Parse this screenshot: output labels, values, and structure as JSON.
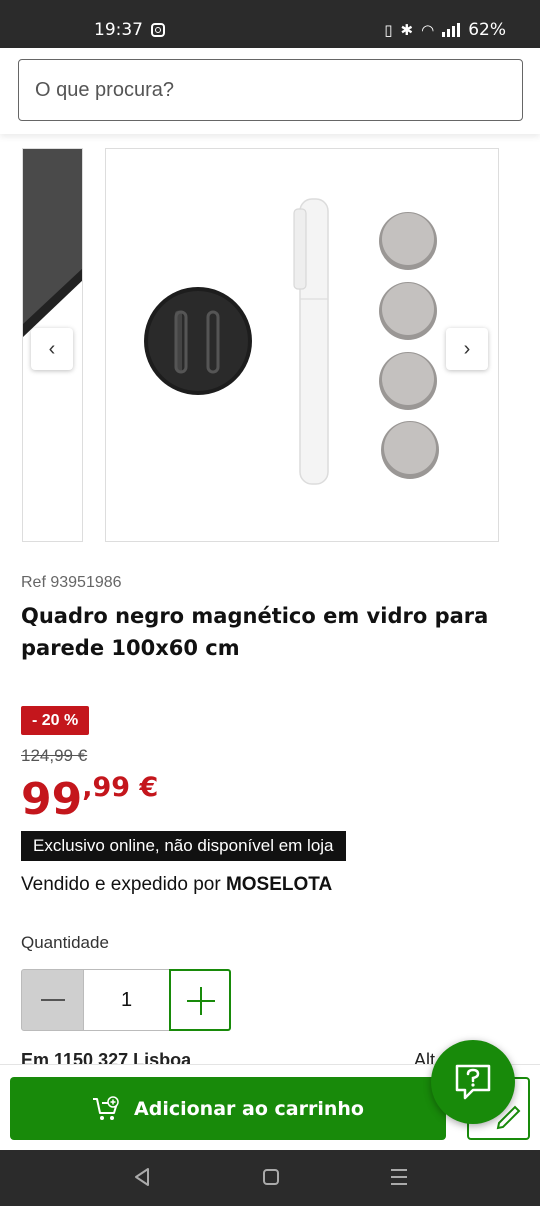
{
  "status_bar": {
    "time": "19:37",
    "battery": "62%",
    "icons": [
      "instagram-icon",
      "vibrate-icon",
      "bluetooth-icon",
      "wifi-icon",
      "signal-icon"
    ]
  },
  "search": {
    "placeholder": "O que procura?"
  },
  "gallery": {
    "prev_icon": "chevron-left-icon",
    "next_icon": "chevron-right-icon",
    "prev_glyph": "‹",
    "next_glyph": "›"
  },
  "product": {
    "ref": "Ref 93951986",
    "title": "Quadro negro magnético em vidro para parede 100x60 cm",
    "discount": "- 20 %",
    "old_price": "124,99 €",
    "price_int": "99",
    "price_dec": ",99 €",
    "exclusive": "Exclusivo online, não disponível em loja",
    "seller_prefix": "Vendido e expedido por ",
    "seller_name": "MOSELOTA"
  },
  "quantity": {
    "label": "Quantidade",
    "value": "1"
  },
  "partial_line": {
    "left": "Em 1150  327 Lisboa",
    "right": "Alt"
  },
  "actions": {
    "add_to_cart": "Adicionar ao carrinho"
  },
  "colors": {
    "brand_green": "#188a0a",
    "price_red": "#c4161c",
    "status_bar": "#2b2b2b"
  }
}
